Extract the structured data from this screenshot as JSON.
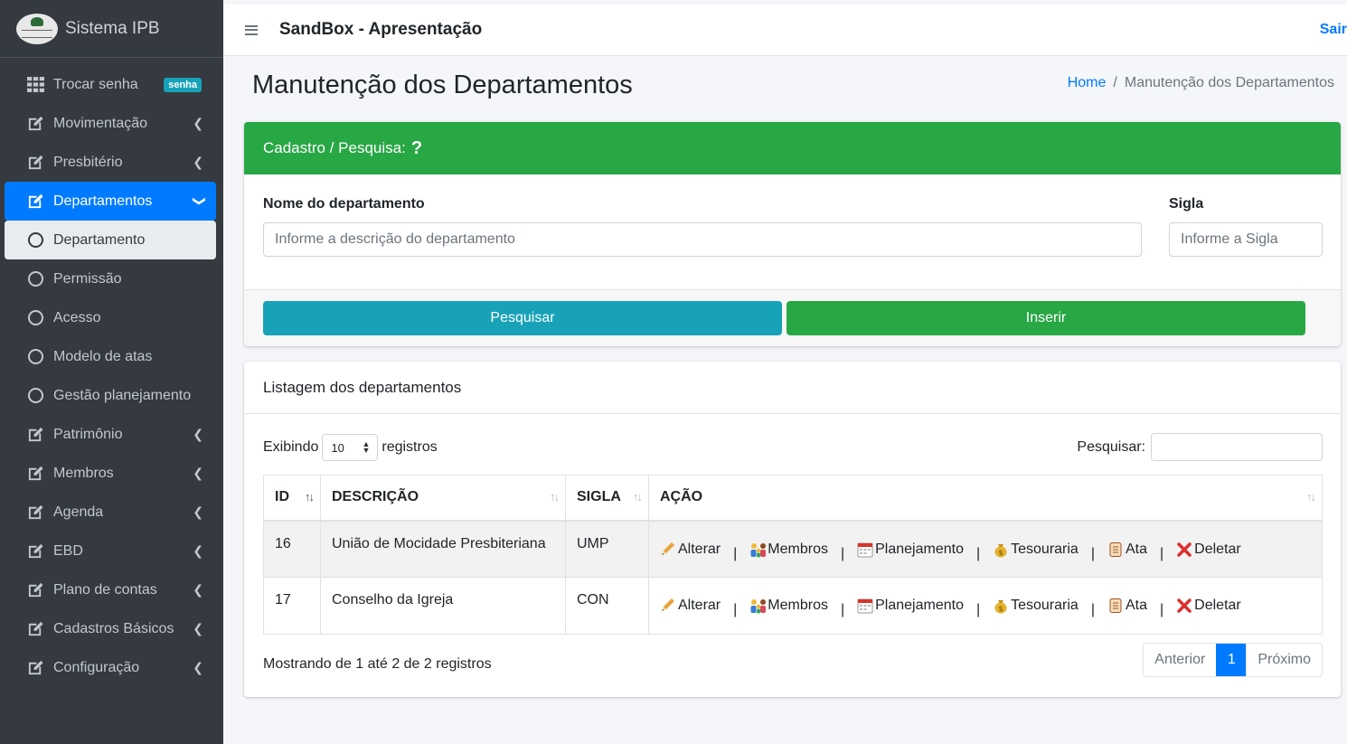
{
  "brand": {
    "name": "Sistema IPB"
  },
  "sidebar": {
    "items": [
      {
        "label": "Trocar senha",
        "badge": "senha",
        "icon": "grid-icon"
      },
      {
        "label": "Movimentação",
        "icon": "edit-icon"
      },
      {
        "label": "Presbitério",
        "icon": "edit-icon"
      },
      {
        "label": "Departamentos",
        "icon": "edit-icon"
      },
      {
        "label": "Departamento",
        "icon": "circle-icon"
      },
      {
        "label": "Permissão",
        "icon": "circle-icon"
      },
      {
        "label": "Acesso",
        "icon": "circle-icon"
      },
      {
        "label": "Modelo de atas",
        "icon": "circle-icon"
      },
      {
        "label": "Gestão planejamento",
        "icon": "circle-icon"
      },
      {
        "label": "Patrimônio",
        "icon": "edit-icon"
      },
      {
        "label": "Membros",
        "icon": "edit-icon"
      },
      {
        "label": "Agenda",
        "icon": "edit-icon"
      },
      {
        "label": "EBD",
        "icon": "edit-icon"
      },
      {
        "label": "Plano de contas",
        "icon": "edit-icon"
      },
      {
        "label": "Cadastros Básicos",
        "icon": "edit-icon"
      },
      {
        "label": "Configuração",
        "icon": "edit-icon"
      }
    ]
  },
  "topbar": {
    "title": "SandBox - Apresentação",
    "logout": "Sair"
  },
  "page": {
    "title": "Manutenção dos Departamentos",
    "breadcrumb": {
      "home": "Home",
      "separator": "/",
      "current": "Manutenção dos Departamentos"
    }
  },
  "form": {
    "header": "Cadastro / Pesquisa:",
    "help": "?",
    "name_label": "Nome do departamento",
    "name_placeholder": "Informe a descrição do departamento",
    "sigla_label": "Sigla",
    "sigla_placeholder": "Informe a Sigla",
    "search_button": "Pesquisar",
    "insert_button": "Inserir"
  },
  "listing": {
    "header": "Listagem dos departamentos",
    "show_prefix": "Exibindo",
    "page_size": "10",
    "show_suffix": "registros",
    "search_label": "Pesquisar:",
    "columns": [
      "ID",
      "DESCRIÇÃO",
      "SIGLA",
      "AÇÃO"
    ],
    "rows": [
      {
        "id": "16",
        "descricao": "União de Mocidade Presbiteriana",
        "sigla": "UMP"
      },
      {
        "id": "17",
        "descricao": "Conselho da Igreja",
        "sigla": "CON"
      }
    ],
    "actions": {
      "alterar": "Alterar",
      "membros": "Membros",
      "planejamento": "Planejamento",
      "tesouraria": "Tesouraria",
      "ata": "Ata",
      "deletar": "Deletar",
      "separator": "|"
    },
    "info": "Mostrando de 1 até 2 de 2 registros",
    "pager": {
      "prev": "Anterior",
      "current": "1",
      "next": "Próximo"
    }
  },
  "colors": {
    "sidebar": "#343a40",
    "primary": "#007bff",
    "success": "#28a745",
    "info": "#17a2b8"
  }
}
